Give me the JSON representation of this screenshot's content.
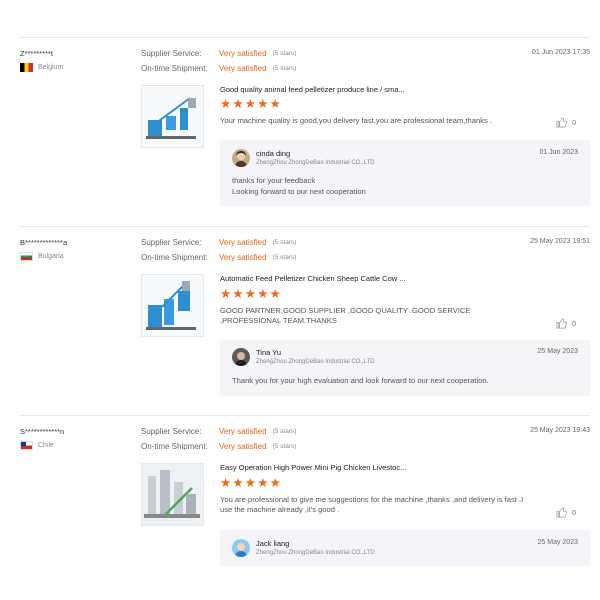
{
  "labels": {
    "supplier_service": "Supplier Service:",
    "on_time_shipment": "On-time Shipment:"
  },
  "reviews": [
    {
      "buyer": "Z*********t",
      "country": "Belgium",
      "date": "01 Jun 2023 17:35",
      "supplier_service": "Very satisfied",
      "supplier_service_stars": "(5 stars)",
      "shipment": "Very satisfied",
      "shipment_stars": "(5 stars)",
      "product_title": "Good quality animal feed pelletizer produce line / sma...",
      "rating": "★★★★★",
      "comment": "Your machine quality is good,you delivery fast,you are professional team,thanks .",
      "likes": "0",
      "reply": {
        "name": "cinda ding",
        "company": "ZhengZhou ZhongDeBao Industrial CO.,LTD",
        "date": "01 Jun 2023",
        "line1": "thanks for your feedback",
        "line2": "Looking forward to our next cooperation"
      }
    },
    {
      "buyer": "B*************a",
      "country": "Bulgaria",
      "date": "25 May 2023 19:51",
      "supplier_service": "Very satisfied",
      "supplier_service_stars": "(5 stars)",
      "shipment": "Very satisfied",
      "shipment_stars": "(5 stars)",
      "product_title": "Automatic Feed Pelletizer Chicken Sheep Cattle Cow ...",
      "rating": "★★★★★",
      "comment": "GOOD PARTNER,GOOD SUPPLIER ,GOOD QUALITY .GOOD SERVICE ,PROFESSIONAL TEAM.THANKS",
      "likes": "0",
      "reply": {
        "name": "Tina Yu",
        "company": "ZhengZhou ZhongDeBao Industrial CO.,LTD",
        "date": "25 May 2023",
        "line1": "Thank you for your high evaluation and look forward to our next cooperation.",
        "line2": ""
      }
    },
    {
      "buyer": "S************n",
      "country": "Chile",
      "date": "25 May 2023 19:43",
      "supplier_service": "Very satisfied",
      "supplier_service_stars": "(5 stars)",
      "shipment": "Very satisfied",
      "shipment_stars": "(5 stars)",
      "product_title": "Easy Operation High Power Mini Pig Chicken Livestoc...",
      "rating": "★★★★★",
      "comment": "You are professional to give me suggestions for the machine ,thanks ,and delivery is fast .I use the machine already ,it's good .",
      "likes": "0",
      "reply": {
        "name": "Jack liang",
        "company": "ZhengZhou ZhongDeBao Industrial CO.,LTD",
        "date": "25 May 2023",
        "line1": "",
        "line2": ""
      }
    }
  ],
  "colors": {
    "accent": "#e8641c",
    "star": "#f06a1e",
    "reply_bg": "#f3f5f8"
  }
}
